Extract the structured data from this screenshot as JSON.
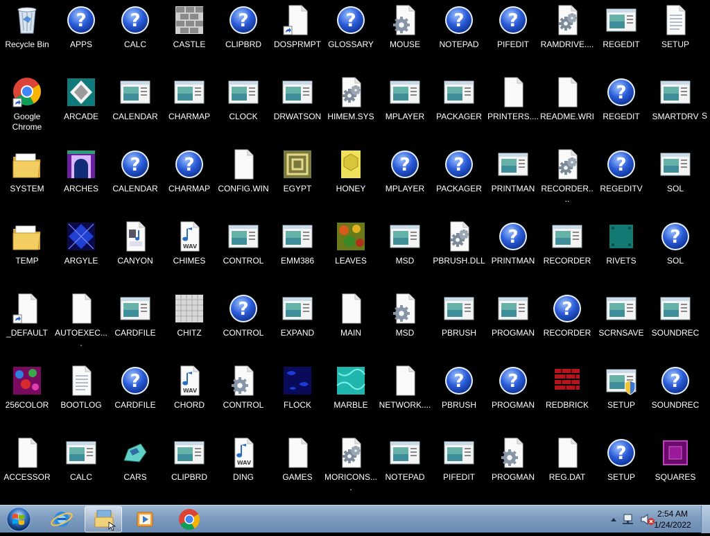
{
  "desktop": {
    "columns": [
      [
        {
          "label": "Recycle Bin",
          "icon": "recycle-bin-icon"
        },
        {
          "label": "Google Chrome",
          "icon": "chrome-shortcut-icon"
        },
        {
          "label": "SYSTEM",
          "icon": "folder-icon"
        },
        {
          "label": "TEMP",
          "icon": "folder-icon"
        },
        {
          "label": "_DEFAULT",
          "icon": "blank-file-shortcut-icon"
        },
        {
          "label": "256COLOR",
          "icon": "bitmap-256color-icon"
        },
        {
          "label": "ACCESSOR",
          "icon": "blank-file-icon"
        }
      ],
      [
        {
          "label": "APPS",
          "icon": "help-file-icon"
        },
        {
          "label": "ARCADE",
          "icon": "bitmap-arcade-icon"
        },
        {
          "label": "ARCHES",
          "icon": "bitmap-arches-icon"
        },
        {
          "label": "ARGYLE",
          "icon": "bitmap-argyle-icon"
        },
        {
          "label": "AUTOEXEC....",
          "icon": "blank-file-icon"
        },
        {
          "label": "BOOTLOG",
          "icon": "text-file-icon"
        },
        {
          "label": "CALC",
          "icon": "application-icon"
        }
      ],
      [
        {
          "label": "CALC",
          "icon": "help-file-icon"
        },
        {
          "label": "CALENDAR",
          "icon": "application-icon"
        },
        {
          "label": "CALENDAR",
          "icon": "help-file-icon"
        },
        {
          "label": "CANYON",
          "icon": "midi-file-icon"
        },
        {
          "label": "CARDFILE",
          "icon": "application-icon"
        },
        {
          "label": "CARDFILE",
          "icon": "help-file-icon"
        },
        {
          "label": "CARS",
          "icon": "cars-icon"
        }
      ],
      [
        {
          "label": "CASTLE",
          "icon": "bitmap-castle-icon"
        },
        {
          "label": "CHARMAP",
          "icon": "application-icon"
        },
        {
          "label": "CHARMAP",
          "icon": "help-file-icon"
        },
        {
          "label": "CHIMES",
          "icon": "wav-file-icon"
        },
        {
          "label": "CHITZ",
          "icon": "bitmap-chitz-icon"
        },
        {
          "label": "CHORD",
          "icon": "wav-file-icon"
        },
        {
          "label": "CLIPBRD",
          "icon": "application-icon"
        }
      ],
      [
        {
          "label": "CLIPBRD",
          "icon": "help-file-icon"
        },
        {
          "label": "CLOCK",
          "icon": "application-icon"
        },
        {
          "label": "CONFIG.WIN",
          "icon": "blank-file-icon"
        },
        {
          "label": "CONTROL",
          "icon": "application-icon"
        },
        {
          "label": "CONTROL",
          "icon": "help-file-icon"
        },
        {
          "label": "CONTROL",
          "icon": "settings-file-icon"
        },
        {
          "label": "DING",
          "icon": "wav-file-icon"
        }
      ],
      [
        {
          "label": "DOSPRMPT",
          "icon": "blank-file-shortcut-icon"
        },
        {
          "label": "DRWATSON",
          "icon": "application-icon"
        },
        {
          "label": "EGYPT",
          "icon": "bitmap-egypt-icon"
        },
        {
          "label": "EMM386",
          "icon": "application-icon"
        },
        {
          "label": "EXPAND",
          "icon": "application-icon"
        },
        {
          "label": "FLOCK",
          "icon": "bitmap-flock-icon"
        },
        {
          "label": "GAMES",
          "icon": "blank-file-icon"
        }
      ],
      [
        {
          "label": "GLOSSARY",
          "icon": "help-file-icon"
        },
        {
          "label": "HIMEM.SYS",
          "icon": "system-file-icon"
        },
        {
          "label": "HONEY",
          "icon": "bitmap-honey-icon"
        },
        {
          "label": "LEAVES",
          "icon": "bitmap-leaves-icon"
        },
        {
          "label": "MAIN",
          "icon": "blank-file-icon"
        },
        {
          "label": "MARBLE",
          "icon": "bitmap-marble-icon"
        },
        {
          "label": "MORICONS....",
          "icon": "system-file-icon"
        }
      ],
      [
        {
          "label": "MOUSE",
          "icon": "settings-file-icon"
        },
        {
          "label": "MPLAYER",
          "icon": "application-icon"
        },
        {
          "label": "MPLAYER",
          "icon": "help-file-icon"
        },
        {
          "label": "MSD",
          "icon": "application-icon"
        },
        {
          "label": "MSD",
          "icon": "settings-file-icon"
        },
        {
          "label": "NETWORK....",
          "icon": "blank-file-icon"
        },
        {
          "label": "NOTEPAD",
          "icon": "application-icon"
        }
      ],
      [
        {
          "label": "NOTEPAD",
          "icon": "help-file-icon"
        },
        {
          "label": "PACKAGER",
          "icon": "application-icon"
        },
        {
          "label": "PACKAGER",
          "icon": "help-file-icon"
        },
        {
          "label": "PBRUSH.DLL",
          "icon": "system-file-icon"
        },
        {
          "label": "PBRUSH",
          "icon": "application-icon"
        },
        {
          "label": "PBRUSH",
          "icon": "help-file-icon"
        },
        {
          "label": "PIFEDIT",
          "icon": "application-icon"
        }
      ],
      [
        {
          "label": "PIFEDIT",
          "icon": "help-file-icon"
        },
        {
          "label": "PRINTERS....",
          "icon": "blank-file-icon"
        },
        {
          "label": "PRINTMAN",
          "icon": "application-icon"
        },
        {
          "label": "PRINTMAN",
          "icon": "help-file-icon"
        },
        {
          "label": "PROGMAN",
          "icon": "application-icon"
        },
        {
          "label": "PROGMAN",
          "icon": "help-file-icon"
        },
        {
          "label": "PROGMAN",
          "icon": "settings-file-icon"
        }
      ],
      [
        {
          "label": "RAMDRIVE....",
          "icon": "system-file-icon"
        },
        {
          "label": "README.WRI",
          "icon": "blank-file-icon"
        },
        {
          "label": "RECORDER....",
          "icon": "system-file-icon"
        },
        {
          "label": "RECORDER",
          "icon": "application-icon"
        },
        {
          "label": "RECORDER",
          "icon": "help-file-icon"
        },
        {
          "label": "REDBRICK",
          "icon": "bitmap-redbrick-icon"
        },
        {
          "label": "REG.DAT",
          "icon": "blank-file-icon"
        }
      ],
      [
        {
          "label": "REGEDIT",
          "icon": "application-icon"
        },
        {
          "label": "REGEDIT",
          "icon": "help-file-icon"
        },
        {
          "label": "REGEDITV",
          "icon": "help-file-icon"
        },
        {
          "label": "RIVETS",
          "icon": "bitmap-rivets-icon"
        },
        {
          "label": "SCRNSAVE",
          "icon": "application-icon"
        },
        {
          "label": "SETUP",
          "icon": "setup-shield-icon"
        },
        {
          "label": "SETUP",
          "icon": "help-file-icon"
        }
      ],
      [
        {
          "label": "SETUP",
          "icon": "text-file-icon"
        },
        {
          "label": "SMARTDRV",
          "icon": "application-icon"
        },
        {
          "label": "SOL",
          "icon": "application-icon"
        },
        {
          "label": "SOL",
          "icon": "help-file-icon"
        },
        {
          "label": "SOUNDREC",
          "icon": "application-icon"
        },
        {
          "label": "SOUNDREC",
          "icon": "help-file-icon"
        },
        {
          "label": "SQUARES",
          "icon": "bitmap-squares-icon"
        }
      ]
    ],
    "clipped_label": "S"
  },
  "taskbar": {
    "clock_time": "2:54 AM",
    "clock_date": "1/24/2022"
  },
  "colors": {
    "desktop_bg": "#000000",
    "help_blue": "#2a5bd7",
    "taskbar": "#7d9bbf"
  }
}
